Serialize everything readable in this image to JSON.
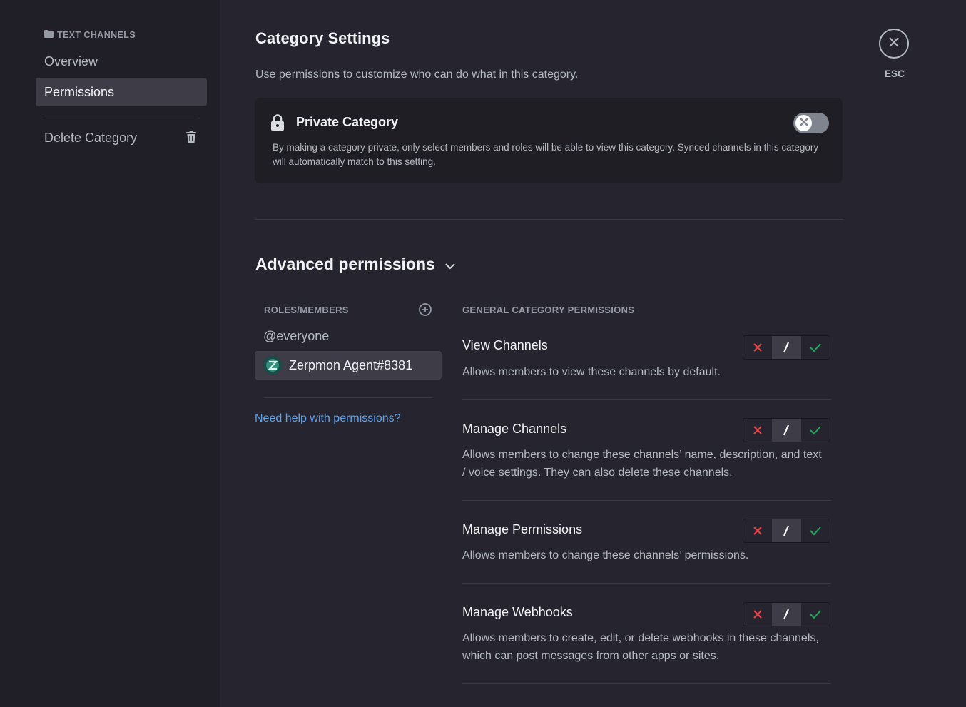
{
  "sidebar": {
    "header": "TEXT CHANNELS",
    "header_icon": "folder-icon",
    "items": [
      {
        "label": "Overview"
      },
      {
        "label": "Permissions",
        "active": true
      }
    ],
    "delete_label": "Delete Category",
    "delete_icon": "trash-icon"
  },
  "page": {
    "title": "Category Settings",
    "description": "Use permissions to customize who can do what in this category."
  },
  "private_category": {
    "title": "Private Category",
    "description": "By making a category private, only select members and roles will be able to view this category. Synced channels in this category will automatically match to this setting.",
    "enabled": false,
    "icon": "lock-icon"
  },
  "advanced": {
    "title": "Advanced permissions",
    "roles_header": "ROLES/MEMBERS",
    "roles": [
      {
        "label": "@everyone"
      },
      {
        "label": "Zerpmon Agent#8381",
        "active": true
      }
    ],
    "help_link": "Need help with permissions?",
    "permissions_header": "GENERAL CATEGORY PERMISSIONS",
    "permissions": [
      {
        "title": "View Channels",
        "description": "Allows members to view these channels by default.",
        "state": "neutral"
      },
      {
        "title": "Manage Channels",
        "description": "Allows members to change these channels’ name, description, and text / voice settings. They can also delete these channels.",
        "state": "neutral"
      },
      {
        "title": "Manage Permissions",
        "description": "Allows members to change these channels’ permissions.",
        "state": "neutral"
      },
      {
        "title": "Manage Webhooks",
        "description": "Allows members to create, edit, or delete webhooks in these channels, which can post messages from other apps or sites.",
        "state": "neutral"
      }
    ]
  },
  "close": {
    "label": "ESC"
  },
  "colors": {
    "deny": "#f23f43",
    "allow": "#23a55a",
    "link": "#5aa3f0"
  }
}
